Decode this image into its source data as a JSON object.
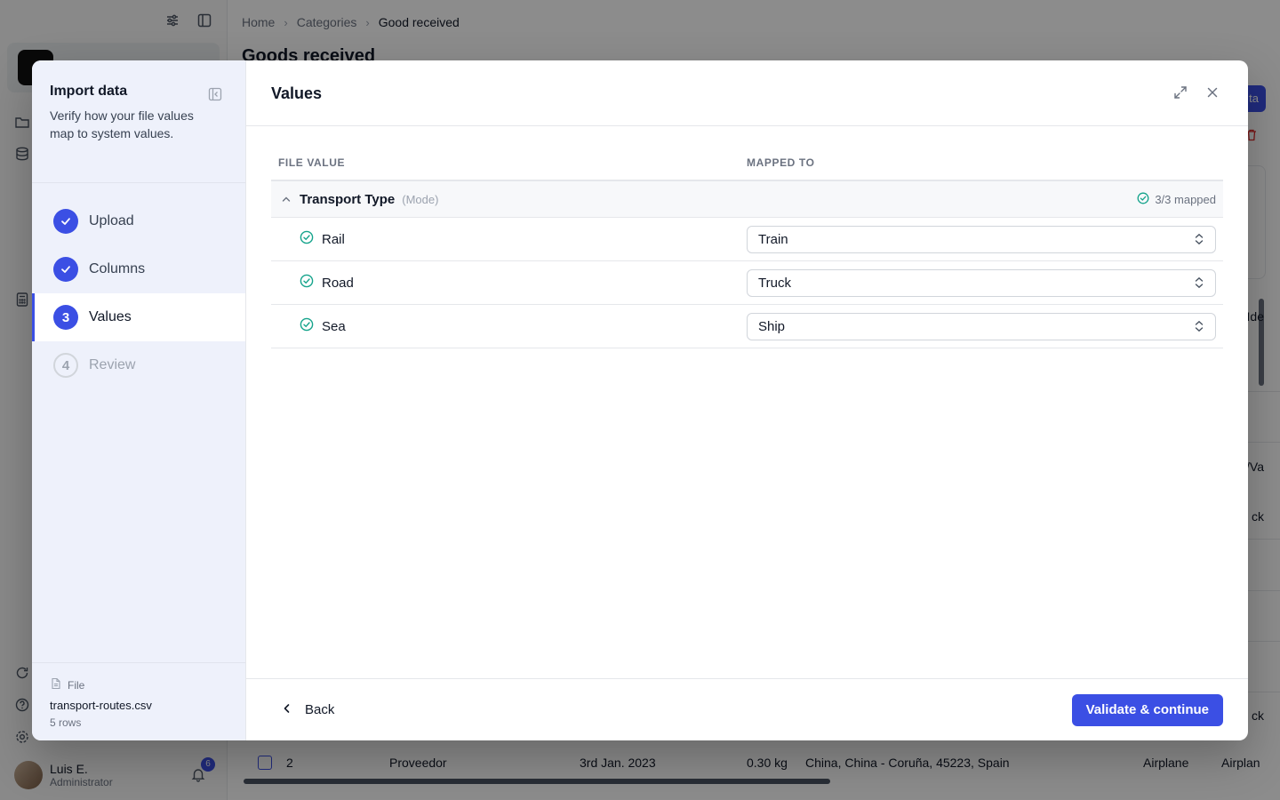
{
  "app": {
    "breadcrumb": [
      "Home",
      "Categories",
      "Good received"
    ],
    "page_title": "Goods received",
    "user": {
      "name": "Luis E.",
      "role": "Administrator",
      "notifications": "6"
    },
    "background_table_row": {
      "index": "2",
      "supplier": "Proveedor",
      "date": "3rd Jan. 2023",
      "weight": "0.30 kg",
      "route": "China, China - Coruña, 45223, Spain",
      "mode": "Airplane",
      "mode_cut": "Airplan"
    },
    "partial_texts": [
      "ta",
      "Ide",
      "/Va",
      "ck",
      "ck"
    ]
  },
  "modal": {
    "wizard": {
      "title": "Import data",
      "description": "Verify how your file values map to system values.",
      "steps": [
        {
          "number": "1",
          "label": "Upload",
          "state": "done"
        },
        {
          "number": "2",
          "label": "Columns",
          "state": "done"
        },
        {
          "number": "3",
          "label": "Values",
          "state": "current"
        },
        {
          "number": "4",
          "label": "Review",
          "state": "todo"
        }
      ],
      "file": {
        "caption": "File",
        "name": "transport-routes.csv",
        "rows": "5 rows"
      }
    },
    "content": {
      "title": "Values",
      "headers": {
        "file_value": "FILE VALUE",
        "mapped_to": "MAPPED TO"
      },
      "group": {
        "name": "Transport Type",
        "subtitle": "(Mode)",
        "status": "3/3 mapped",
        "values": [
          {
            "file_value": "Rail",
            "mapped_to": "Train"
          },
          {
            "file_value": "Road",
            "mapped_to": "Truck"
          },
          {
            "file_value": "Sea",
            "mapped_to": "Ship"
          }
        ]
      }
    },
    "footer": {
      "back_label": "Back",
      "primary_label": "Validate & continue"
    }
  },
  "colors": {
    "accent": "#3b4fe4",
    "success": "#14a38b"
  },
  "icons": [
    "sliders-icon",
    "sidebar-toggle-icon",
    "folder-icon",
    "database-icon",
    "calculator-icon",
    "refresh-icon",
    "help-icon",
    "gear-icon",
    "bell-icon",
    "collapse-panel-icon",
    "expand-icon",
    "close-icon",
    "chevron-up-icon",
    "check-circle-icon",
    "chevron-up-down-icon",
    "chevron-left-icon",
    "file-icon",
    "check-icon",
    "trash-icon"
  ]
}
